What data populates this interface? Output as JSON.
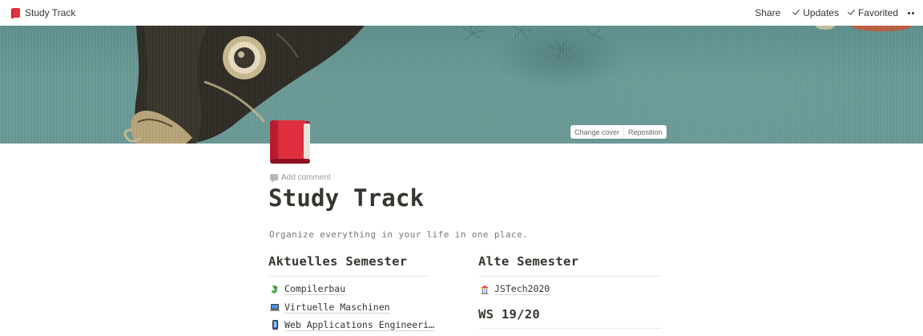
{
  "topbar": {
    "page_title": "Study Track",
    "page_icon": "red-book-icon",
    "share_label": "Share",
    "updates_label": "Updates",
    "favorited_label": "Favorited",
    "more_icon": "more-dots-icon"
  },
  "cover": {
    "change_cover_label": "Change cover",
    "reposition_label": "Reposition",
    "image_colors": {
      "water": "#6a9996",
      "carp": "#2e2b24"
    }
  },
  "page": {
    "icon": "red-book-icon",
    "add_comment_label": "Add comment",
    "title": "Study Track",
    "subtitle": "Organize everything in your life in one place."
  },
  "columns": {
    "left": {
      "heading": "Aktuelles Semester",
      "items": [
        {
          "icon": "dragon-icon",
          "label": "Compilerbau"
        },
        {
          "icon": "laptop-icon",
          "label": "Virtuelle Maschinen"
        },
        {
          "icon": "mobile-phone-icon",
          "label": "Web Applications Engineeri…"
        }
      ]
    },
    "right": {
      "heading": "Alte Semester",
      "items": [
        {
          "icon": "carousel-icon",
          "label": "JSTech2020"
        }
      ],
      "subheading": "WS 19/20"
    }
  }
}
